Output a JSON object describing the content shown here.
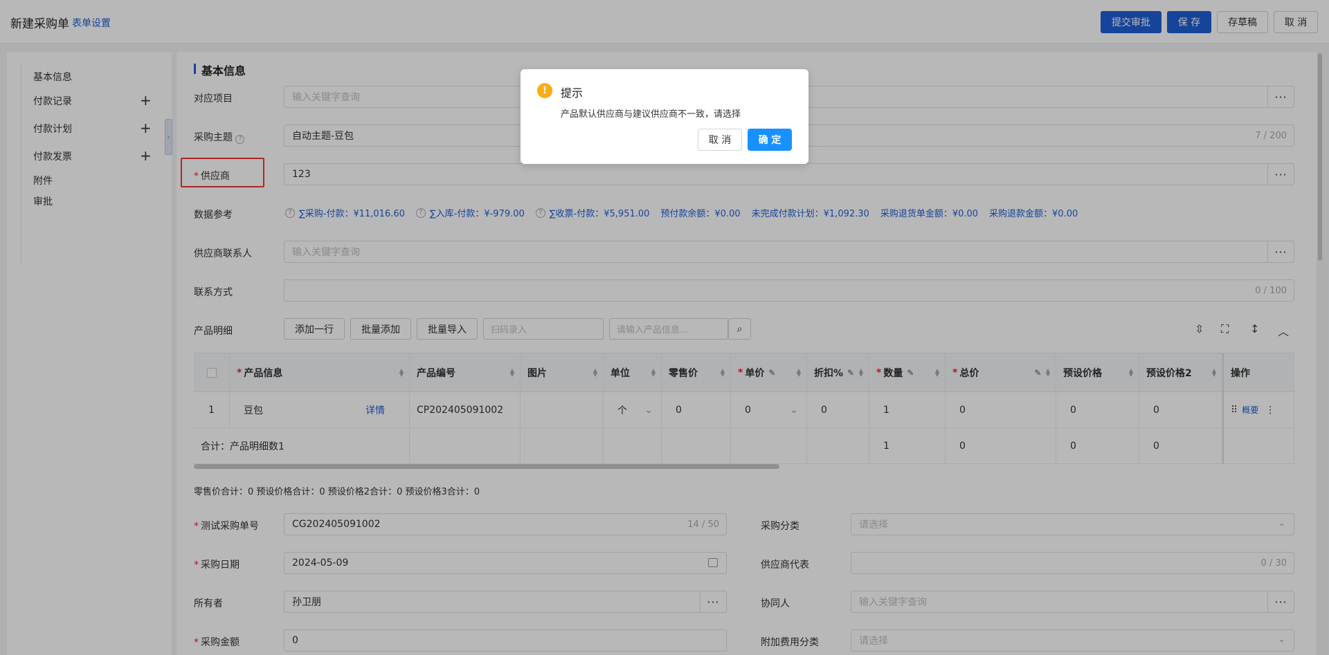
{
  "header": {
    "title": "新建采购单",
    "form_settings": "表单设置",
    "actions": {
      "submit": "提交审批",
      "save": "保 存",
      "draft": "存草稿",
      "cancel": "取 消"
    }
  },
  "sidebar": {
    "items": [
      {
        "label": "基本信息"
      },
      {
        "label": "付款记录",
        "plus": "+"
      },
      {
        "label": "付款计划",
        "plus": "+"
      },
      {
        "label": "付款发票",
        "plus": "+"
      },
      {
        "label": "附件"
      },
      {
        "label": "审批"
      }
    ],
    "collapse": "‹"
  },
  "section": {
    "title": "基本信息"
  },
  "form": {
    "project": {
      "label": "对应项目",
      "placeholder": "输入关键字查询"
    },
    "subject": {
      "label": "采购主题",
      "help": "?",
      "value": "自动主题-豆包",
      "count": "7 / 200"
    },
    "supplier": {
      "label": "供应商",
      "required": "*",
      "value": "123"
    },
    "data_ref": {
      "label": "数据参考",
      "items": [
        "∑采购-付款：¥11,016.60",
        "∑入库-付款：¥-979.00",
        "∑收票-付款：¥5,951.00"
      ],
      "plain": [
        "预付款余额：¥0.00",
        "未完成付款计划：¥1,092.30",
        "采购退货单金额：¥0.00",
        "采购退款金额：¥0.00"
      ]
    },
    "contact": {
      "label": "供应商联系人",
      "placeholder": "输入关键字查询"
    },
    "phone": {
      "label": "联系方式",
      "count": "0 / 100"
    },
    "dots": "···"
  },
  "products": {
    "label": "产品明细",
    "buttons": {
      "add_row": "添加一行",
      "batch_add": "批量添加",
      "batch_import": "批量导入"
    },
    "scan_placeholder": "扫码录入",
    "search_placeholder": "请输入产品信息...",
    "columns": [
      "产品信息",
      "产品编号",
      "图片",
      "单位",
      "零售价",
      "单价",
      "折扣%",
      "数量",
      "总价",
      "预设价格",
      "预设价格2",
      "操作"
    ],
    "required_mark": "*",
    "rows": [
      {
        "index": "1",
        "name": "豆包",
        "detail": "详情",
        "code": "CP202405091002",
        "unit": "个",
        "retail": "0",
        "price": "0",
        "discount": "0",
        "qty": "1",
        "total": "0",
        "preset": "0",
        "preset2": "0",
        "op_summary": "概要",
        "op_drag": "⠿",
        "op_more": "⋮"
      }
    ],
    "total_row": {
      "label": "合计：产品明细数1",
      "qty": "1",
      "total": "0",
      "preset": "0",
      "preset2": "0"
    },
    "summary": "零售价合计：0  预设价格合计：0  预设价格2合计：0  预设价格3合计：0"
  },
  "form2": {
    "po_number": {
      "label": "测试采购单号",
      "required": "*",
      "value": "CG202405091002",
      "count": "14 / 50"
    },
    "category": {
      "label": "采购分类",
      "placeholder": "请选择"
    },
    "date": {
      "label": "采购日期",
      "required": "*",
      "value": "2024-05-09"
    },
    "rep": {
      "label": "供应商代表",
      "count": "0 / 30"
    },
    "owner": {
      "label": "所有者",
      "value": "孙卫朋"
    },
    "collab": {
      "label": "协同人",
      "placeholder": "输入关键字查询"
    },
    "amount": {
      "label": "采购金额",
      "required": "*",
      "value": "0"
    },
    "extra_fee": {
      "label": "附加费用分类",
      "placeholder": "请选择"
    }
  },
  "dialog": {
    "icon": "!",
    "title": "提示",
    "message": "产品默认供应商与建议供应商不一致，请选择",
    "cancel": "取 消",
    "ok": "确 定"
  }
}
